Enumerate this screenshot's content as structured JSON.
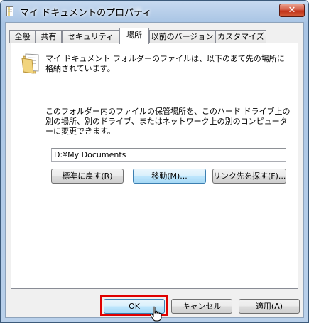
{
  "window": {
    "title": "マイ ドキュメントのプロパティ",
    "close_label": "✕"
  },
  "tabs": [
    {
      "label": "全般",
      "active": false
    },
    {
      "label": "共有",
      "active": false
    },
    {
      "label": "セキュリティ",
      "active": false
    },
    {
      "label": "場所",
      "active": true
    },
    {
      "label": "以前のバージョン",
      "active": false
    },
    {
      "label": "カスタマイズ",
      "active": false
    }
  ],
  "location": {
    "description1": "マイ ドキュメント フォルダーのファイルは、以下のあて先の場所に格納されています。",
    "description2": "このフォルダー内のファイルの保管場所を、このハード ドライブ上の別の場所、別のドライブ、またはネットワーク上の別のコンピューターに変更できます。",
    "path_value": "D:¥My Documents",
    "restore_default_label": "標準に戻す(R)",
    "move_label": "移動(M)...",
    "find_target_label": "リンク先を探す(F)..."
  },
  "footer": {
    "ok_label": "OK",
    "cancel_label": "キャンセル",
    "apply_label": "適用(A)"
  },
  "colors": {
    "highlight": "#e00000",
    "close_button": "#c03018"
  }
}
